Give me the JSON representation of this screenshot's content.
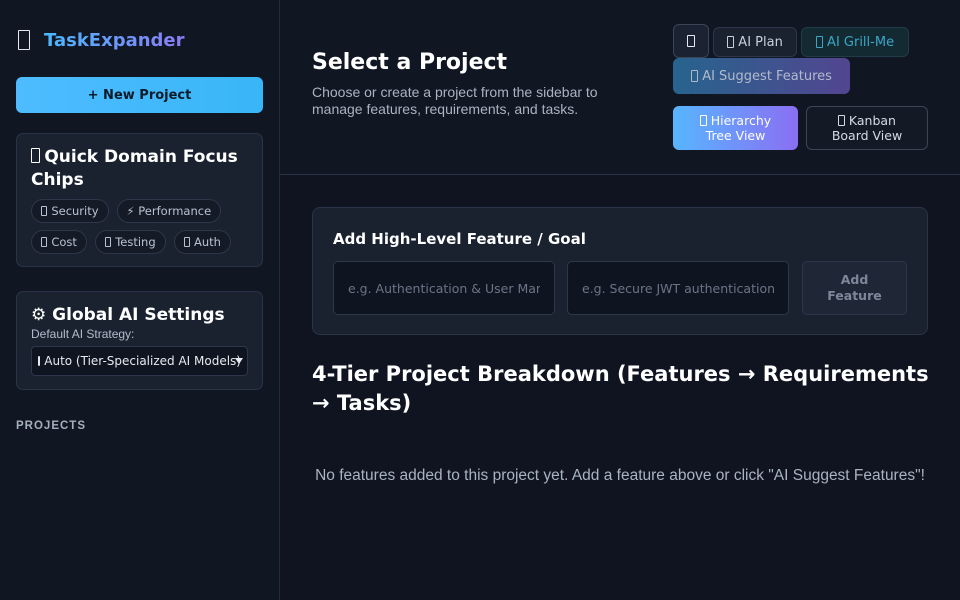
{
  "brand": {
    "name": "TaskExpander",
    "icon": "app-icon"
  },
  "sidebar": {
    "new_project_label": "+ New Project",
    "focus_chips": {
      "title": "Quick Domain Focus Chips",
      "chips": [
        {
          "label": "Security",
          "icon": "lock-icon"
        },
        {
          "label": "⚡ Performance",
          "icon": "lightning-icon"
        },
        {
          "label": "Cost",
          "icon": "money-icon"
        },
        {
          "label": "Testing",
          "icon": "test-icon"
        },
        {
          "label": "Auth",
          "icon": "key-icon"
        }
      ]
    },
    "ai_settings": {
      "title": "⚙ Global AI Settings",
      "strategy_label": "Default AI Strategy:",
      "strategy_value": "Auto (Tier-Specialized AI Models)"
    },
    "projects_label": "PROJECTS"
  },
  "header": {
    "title": "Select a Project",
    "subtitle": "Choose or create a project from the sidebar to manage features, requirements, and tasks.",
    "buttons": {
      "ai_plan": "AI Plan",
      "ai_grill": "AI Grill-Me",
      "ai_suggest": "AI Suggest Features",
      "tree_view_line1": "Hierarchy",
      "tree_view_line2": "Tree View",
      "kanban_line1": "Kanban",
      "kanban_line2": "Board View"
    }
  },
  "feature_form": {
    "title": "Add High-Level Feature / Goal",
    "title_placeholder": "e.g. Authentication & User Management",
    "desc_placeholder": "e.g. Secure JWT authentication",
    "add_label_line1": "Add",
    "add_label_line2": "Feature"
  },
  "breakdown": {
    "title": "4-Tier Project Breakdown (Features → Requirements → Tasks)",
    "empty_message": "No features added to this project yet. Add a feature above or click \"AI Suggest Features\"!"
  },
  "colors": {
    "accent": "#4ebcff",
    "accent2": "#8a6ff3",
    "background": "#0f1420",
    "sidebar": "#111722"
  }
}
